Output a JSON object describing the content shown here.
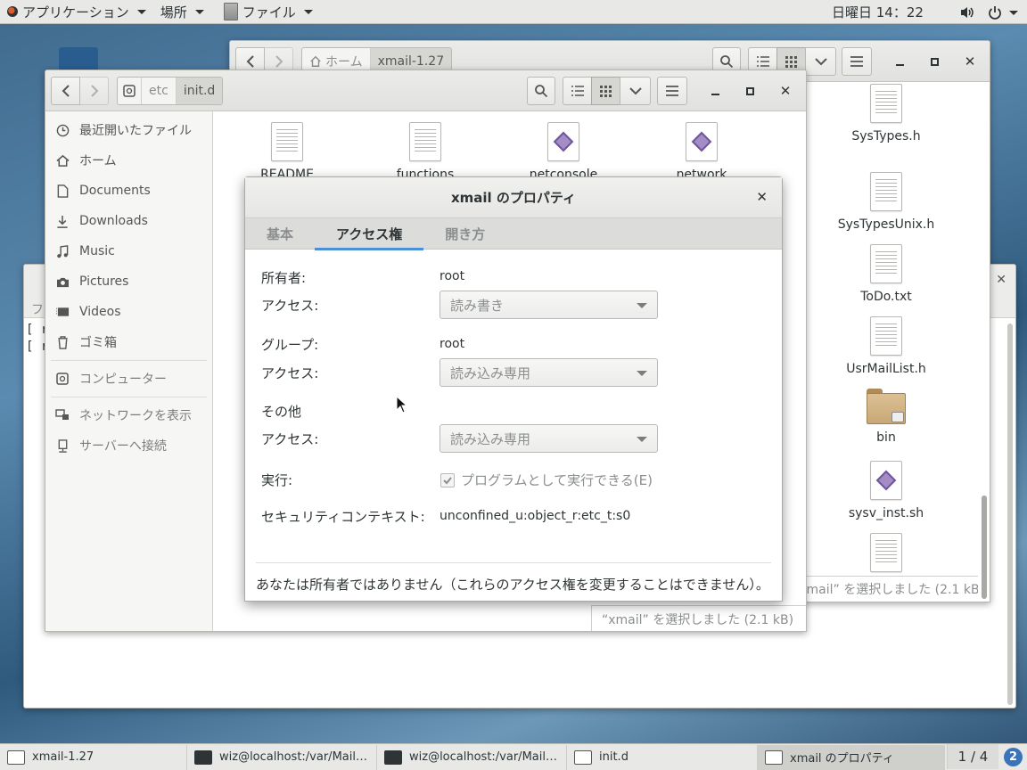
{
  "topbar": {
    "apps_label": "アプリケーション",
    "places_label": "場所",
    "files_label": "ファイル",
    "clock": "日曜日 14：22"
  },
  "back_window": {
    "crumbs": [
      "ホーム",
      "xmail-1.27"
    ],
    "files": [
      "SysTypes.h",
      "SysTypesUnix.h",
      "ToDo.txt",
      "UsrMailList.h",
      "bin",
      "sysv_inst.sh"
    ],
    "status": "“xmail” を選択しました (2.1 kB)"
  },
  "terminal": {
    "menu_label": "ファ",
    "lines": [
      "[ ro",
      "[ ro"
    ]
  },
  "front_window": {
    "crumbs": [
      "etc",
      "init.d"
    ],
    "sidebar": [
      {
        "label": "最近開いたファイル",
        "icon": "clock-icon"
      },
      {
        "label": "ホーム",
        "icon": "home-icon"
      },
      {
        "label": "Documents",
        "icon": "document-icon"
      },
      {
        "label": "Downloads",
        "icon": "download-icon"
      },
      {
        "label": "Music",
        "icon": "music-icon"
      },
      {
        "label": "Pictures",
        "icon": "camera-icon"
      },
      {
        "label": "Videos",
        "icon": "video-icon"
      },
      {
        "label": "ゴミ箱",
        "icon": "trash-icon"
      },
      {
        "label": "コンピューター",
        "icon": "drive-icon"
      },
      {
        "label": "ネットワークを表示",
        "icon": "network-icon"
      },
      {
        "label": "サーバーへ接続",
        "icon": "server-icon"
      }
    ],
    "files": [
      "README",
      "functions",
      "netconsole",
      "network"
    ],
    "status": "“xmail” を選択しました (2.1 kB)"
  },
  "dialog": {
    "title": "xmail のプロパティ",
    "tabs": [
      "基本",
      "アクセス権",
      "開き方"
    ],
    "owner_label": "所有者:",
    "owner_value": "root",
    "owner_access_label": "アクセス:",
    "owner_access_value": "読み書き",
    "group_label": "グループ:",
    "group_value": "root",
    "group_access_label": "アクセス:",
    "group_access_value": "読み込み専用",
    "others_label": "その他",
    "others_access_label": "アクセス:",
    "others_access_value": "読み込み専用",
    "exec_label": "実行:",
    "exec_checkbox_label": "プログラムとして実行できる(E)",
    "exec_checked": true,
    "context_label": "セキュリティコンテキスト:",
    "context_value": "unconfined_u:object_r:etc_t:s0",
    "notice": "あなたは所有者ではありません（これらのアクセス権を変更することはできません）。"
  },
  "taskbar": {
    "tasks": [
      "xmail-1.27",
      "wiz@localhost:/var/Mail…",
      "wiz@localhost:/var/Mail…",
      "init.d",
      "xmail のプロパティ"
    ],
    "workspace": "1 / 4",
    "help": "2"
  }
}
